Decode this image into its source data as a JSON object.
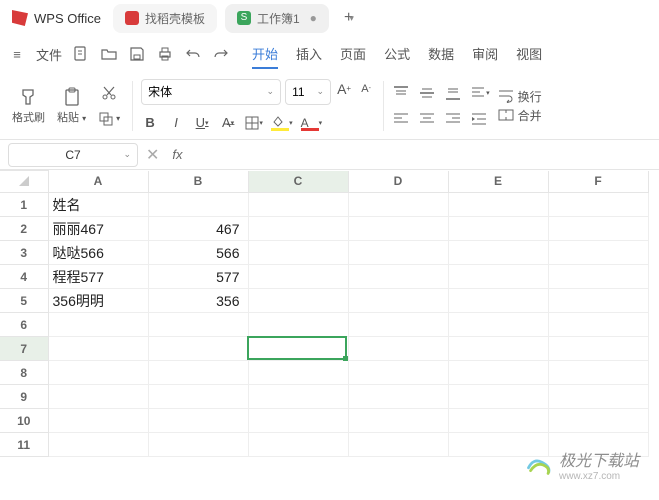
{
  "titlebar": {
    "app_name": "WPS Office",
    "tabs": [
      {
        "label": "找稻壳模板",
        "icon_color": "#d83b3b"
      },
      {
        "label": "工作簿1",
        "icon_color": "#3ba55c",
        "closable": true
      }
    ],
    "plus": "+"
  },
  "menubar": {
    "file": "文件",
    "tabs": [
      "开始",
      "插入",
      "页面",
      "公式",
      "数据",
      "审阅",
      "视图"
    ],
    "active_tab": "开始"
  },
  "ribbon": {
    "format_painter": "格式刷",
    "paste": "粘贴",
    "font_name": "宋体",
    "font_size": "11",
    "wrap": "换行",
    "merge": "合并"
  },
  "formula": {
    "cell_ref": "C7",
    "fx": "fx",
    "value": ""
  },
  "grid": {
    "columns": [
      "A",
      "B",
      "C",
      "D",
      "E",
      "F"
    ],
    "rows": 11,
    "active_col": 2,
    "active_row": 6,
    "data": [
      {
        "r": 0,
        "c": 0,
        "v": "姓名",
        "t": "text"
      },
      {
        "r": 1,
        "c": 0,
        "v": "丽丽467",
        "t": "text"
      },
      {
        "r": 1,
        "c": 1,
        "v": "467",
        "t": "num"
      },
      {
        "r": 2,
        "c": 0,
        "v": "哒哒566",
        "t": "text"
      },
      {
        "r": 2,
        "c": 1,
        "v": "566",
        "t": "num"
      },
      {
        "r": 3,
        "c": 0,
        "v": "程程577",
        "t": "text"
      },
      {
        "r": 3,
        "c": 1,
        "v": "577",
        "t": "num"
      },
      {
        "r": 4,
        "c": 0,
        "v": "356明明",
        "t": "text"
      },
      {
        "r": 4,
        "c": 1,
        "v": "356",
        "t": "num"
      }
    ]
  },
  "watermark": {
    "text": "极光下载站",
    "url": "www.xz7.com"
  }
}
